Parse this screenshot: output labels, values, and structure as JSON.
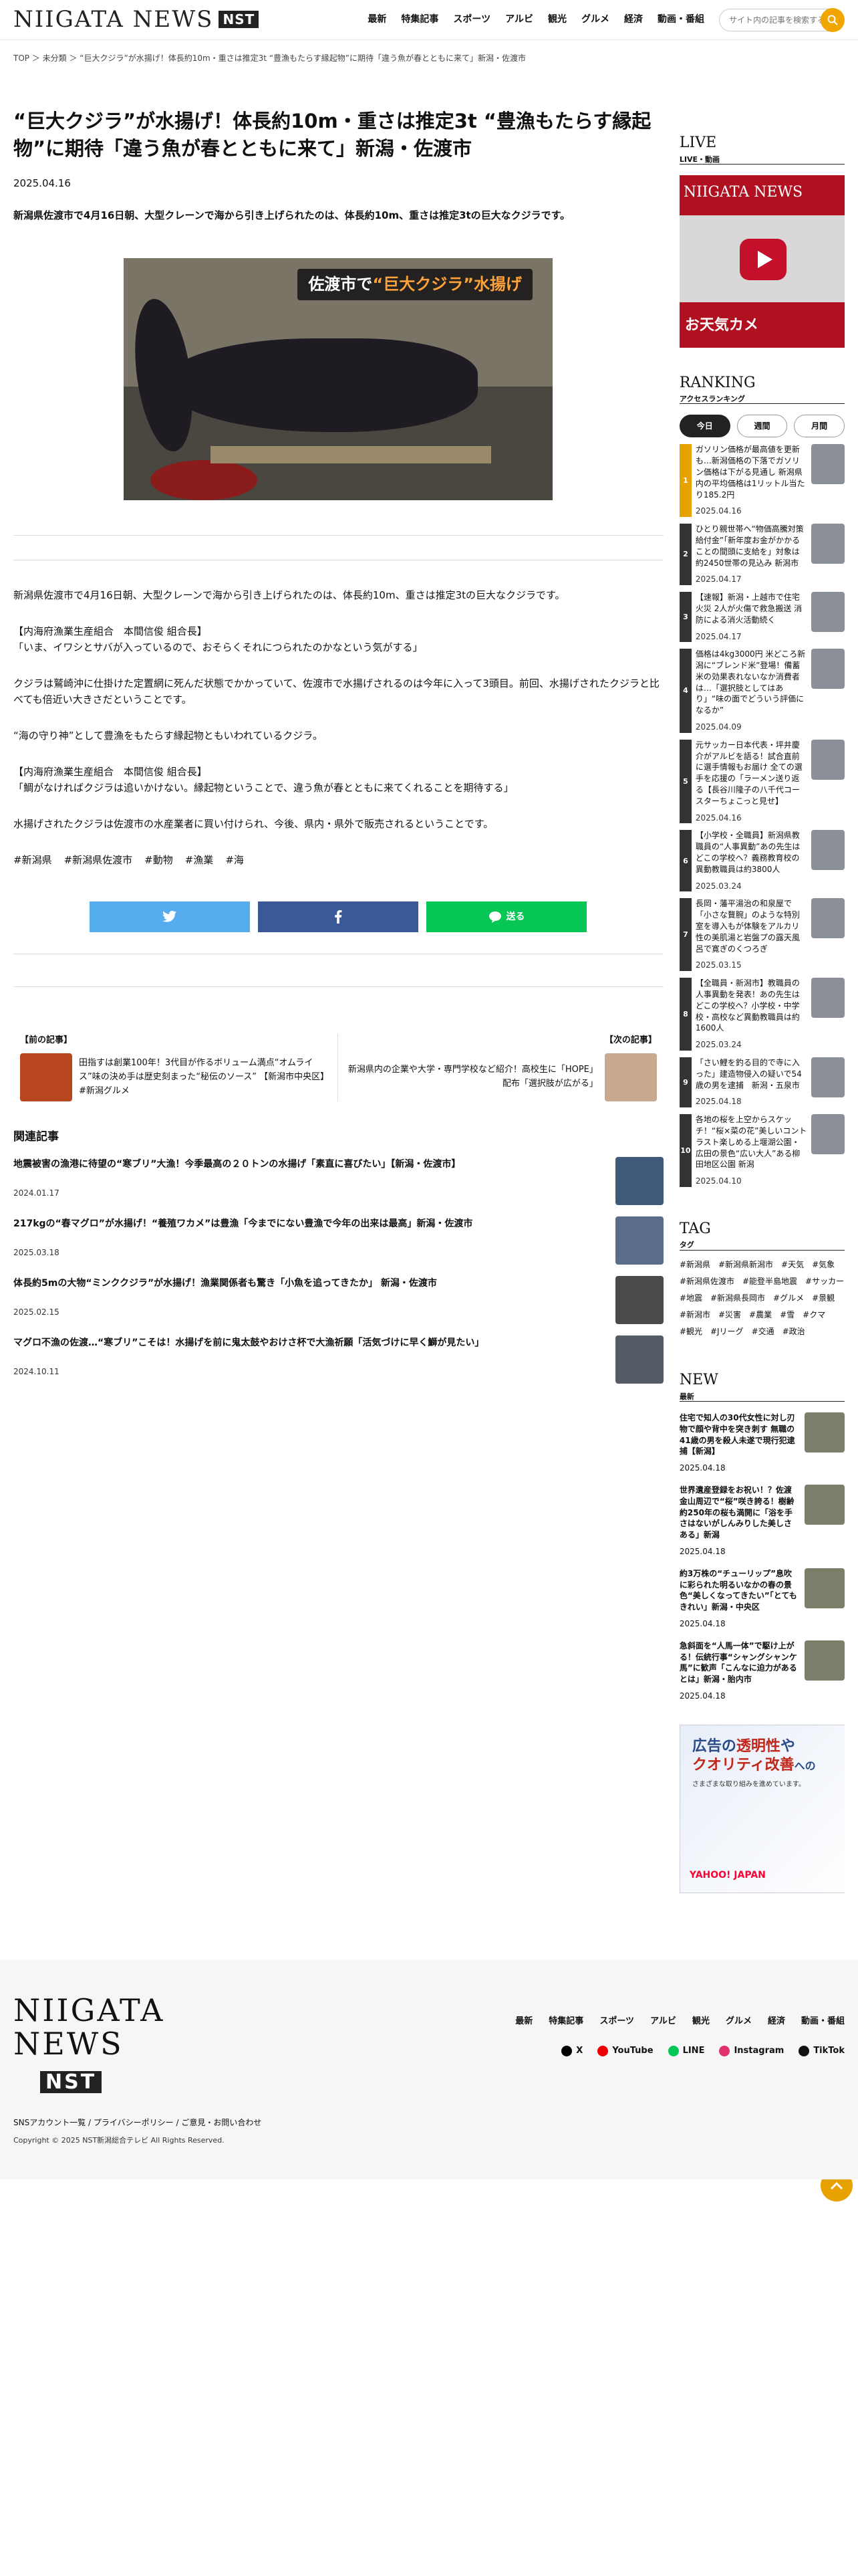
{
  "header": {
    "logo_text": "NIIGATA NEWS",
    "logo_badge": "NST",
    "nav": [
      "最新",
      "特集記事",
      "スポーツ",
      "アルビ",
      "観光",
      "グルメ",
      "経済",
      "動画・番組"
    ],
    "search_placeholder": "サイト内の記事を検索する"
  },
  "breadcrumb": "TOP ＞ 未分類 ＞ “巨大クジラ”が水揚げ！体長約10m・重さは推定3t “豊漁もたらす縁起物”に期待「違う魚が春とともに来て」新潟・佐渡市",
  "article": {
    "title": "“巨大クジラ”が水揚げ！体長約10m・重さは推定3t “豊漁もたらす縁起物”に期待「違う魚が春とともに来て」新潟・佐渡市",
    "date": "2025.04.16",
    "lead": "新潟県佐渡市で4月16日朝、大型クレーンで海から引き上げられたのは、体長約10m、重さは推定3tの巨大なクジラです。",
    "image_caption_a": "佐渡市で",
    "image_caption_b": "“巨大クジラ”水揚げ",
    "paragraphs": [
      "新潟県佐渡市で4月16日朝、大型クレーンで海から引き上げられたのは、体長約10m、重さは推定3tの巨大なクジラです。",
      "【内海府漁業生産組合　本間信俊 組合長】\n「いま、イワシとサバが入っているので、おそらくそれにつられたのかなという気がする」",
      "クジラは鷲崎沖に仕掛けた定置網に死んだ状態でかかっていて、佐渡市で水揚げされるのは今年に入って3頭目。前回、水揚げされたクジラと比べても倍近い大きさだということです。",
      "“海の守り神”として豊漁をもたらす縁起物ともいわれているクジラ。",
      "【内海府漁業生産組合　本間信俊 組合長】\n「鯛がなければクジラは追いかけない。縁起物ということで、違う魚が春とともに来てくれることを期待する」",
      "水揚げされたクジラは佐渡市の水産業者に買い付けられ、今後、県内・県外で販売されるということです。"
    ],
    "tags": [
      "#新潟県",
      "#新潟県佐渡市",
      "#動物",
      "#漁業",
      "#海"
    ],
    "share": {
      "x": "",
      "facebook": "",
      "line": "送る"
    }
  },
  "prevnext": {
    "prev_label": "【前の記事】",
    "prev_title": "田指すは創業100年！3代目が作るボリューム満点“オムライス”味の決め手は歴史刻まった“秘伝のソース” 【新潟市中央区】#新潟グルメ",
    "next_label": "【次の記事】",
    "next_title": "新潟県内の企業や大学・専門学校など紹介！高校生に「HOPE」配布「選択肢が広がる」"
  },
  "related": {
    "heading": "関連記事",
    "items": [
      {
        "title": "地震被害の漁港に待望の“寒ブリ”大漁！今季最高の２０トンの水揚げ「素直に喜びたい」【新潟・佐渡市】",
        "date": "2024.01.17"
      },
      {
        "title": "217kgの“春マグロ”が水揚げ！“養殖ワカメ”は豊漁「今までにない豊漁で今年の出来は最高」新潟・佐渡市",
        "date": "2025.03.18"
      },
      {
        "title": "体長約5mの大物“ミンククジラ”が水揚げ！漁業関係者も驚き「小魚を追ってきたか」 新潟・佐渡市",
        "date": "2025.02.15"
      },
      {
        "title": "マグロ不漁の佐渡…“寒ブリ”こそは！水揚げを前に鬼太鼓やおけさ杯で大漁祈願「活気づけに早く鰤が見たい」",
        "date": "2024.10.11"
      }
    ]
  },
  "sidebar": {
    "live": {
      "heading": "LIVE",
      "sub": "LIVE・動画",
      "banner": "お天気カメ"
    },
    "ranking": {
      "heading": "RANKING",
      "sub": "アクセスランキング",
      "tabs": [
        "今日",
        "週間",
        "月間"
      ],
      "items": [
        {
          "n": "1",
          "title": "ガソリン価格が最高値を更新も…新潟価格の下落でガソリン価格は下がる見通し 新潟県内の平均価格は1リットル当たり185.2円",
          "date": "2025.04.16"
        },
        {
          "n": "2",
          "title": "ひとり親世帯へ“物価高騰対策給付金”「新年度お金がかかることの間頭に支給を」対象は約2450世帯の見込み 新潟市",
          "date": "2025.04.17"
        },
        {
          "n": "3",
          "title": "【速報】新潟・上越市で住宅火災 2人が火傷で救急搬送 消防による消火活動続く",
          "date": "2025.04.17"
        },
        {
          "n": "4",
          "title": "価格は4kg3000円 米どころ新潟に“ブレンド米”登場！備蓄米の効果表れないなか消費者は…「選択肢としてはあり」“味の面でどういう評価になるか”",
          "date": "2025.04.09"
        },
        {
          "n": "5",
          "title": "元サッカー日本代表・坪井慶介がアルビを語る！試合直前に選手情報もお届け 全ての選手を応援の「ラーメン送り返る【長谷川隆子の八千代コースターちょこっと見せ】",
          "date": "2025.04.16"
        },
        {
          "n": "6",
          "title": "【小学校・全職員】新潟県教職員の“人事異動”あの先生はどこの学校へ？義務教育校の異動教職員は約3800人",
          "date": "2025.03.24"
        },
        {
          "n": "7",
          "title": "長岡・藩平湯治の和泉屋で「小さな贅腕」のような特別室を導入もが体験をアルカリ性の美肌湯と岩盤プの露天風呂で寛ぎのくつろぎ",
          "date": "2025.03.15"
        },
        {
          "n": "8",
          "title": "【全職員・新潟市】教職員の人事異動を発表！あの先生はどこの学校へ？小学校・中学校・高校など異動教職員は約1600人",
          "date": "2025.03.24"
        },
        {
          "n": "9",
          "title": "「さい鯉を釣る目的で寺に入った」建造物侵入の疑いで54歳の男を逮捕　新潟・五泉市",
          "date": "2025.04.18"
        },
        {
          "n": "10",
          "title": "各地の桜を上空からスケッチ！“桜×菜の花”美しいコントラスト楽しめる上堰湖公園・広田の景色“広い大人”ある柳田地区公園 新潟",
          "date": "2025.04.10"
        }
      ]
    },
    "tag": {
      "heading": "TAG",
      "sub": "タグ",
      "items": [
        "#新潟県",
        "#新潟県新潟市",
        "#天気",
        "#気象",
        "#新潟県佐渡市",
        "#能登半島地震",
        "#サッカー",
        "#地震",
        "#新潟県長岡市",
        "#グルメ",
        "#景観",
        "#新潟市",
        "#災害",
        "#農業",
        "#雪",
        "#クマ",
        "#観光",
        "#Jリーグ",
        "#交通",
        "#政治"
      ]
    },
    "new": {
      "heading": "NEW",
      "sub": "最新",
      "items": [
        {
          "title": "住宅で知人の30代女性に対し刃物で顔や背中を突き刺す 無職の41歳の男を殺人未遂で現行犯逮捕【新潟】",
          "date": "2025.04.18"
        },
        {
          "title": "世界遺産登録をお祝い！？佐渡金山周辺で“桜”咲き誇る！樹齢約250年の桜も満開に「浴を手さはないがしんみりした美しさある」新潟",
          "date": "2025.04.18"
        },
        {
          "title": "約3万株の“チューリップ”息吹に彩られた明るいなかの春の景色“美しくなってきたい”「とてもきれい」新潟・中央区",
          "date": "2025.04.18"
        },
        {
          "title": "急斜面を“人馬一体”で駆け上がる！伝統行事“シャングシャンケ馬”に歓声「こんなに迫力があるとは」新潟・胎内市",
          "date": "2025.04.18"
        }
      ]
    },
    "ad": {
      "line1a": "広告の",
      "line1b": "透明性",
      "line1c": "や",
      "line2a": "クオリティ改善",
      "line2b": "への",
      "line3": "さまざまな取り組みを進めています。",
      "brand": "YAHOO! JAPAN"
    }
  },
  "footer": {
    "logo_text": "NIIGATA NEWS",
    "logo_badge": "NST",
    "nav": [
      "最新",
      "特集記事",
      "スポーツ",
      "アルビ",
      "観光",
      "グルメ",
      "経済",
      "動画・番組"
    ],
    "sns": [
      "X",
      "YouTube",
      "LINE",
      "Instagram",
      "TikTok"
    ],
    "links": "SNSアカウント一覧 / プライバシーポリシー / ご意見・お問い合わせ",
    "copyright": "Copyright © 2025 NST新潟総合テレビ All Rights Reserved."
  },
  "colors": {
    "accent": "#e8a200",
    "twitter": "#55acee",
    "facebook": "#3b5998",
    "line": "#06c755",
    "rank_top": "#e8a200",
    "rank_other": "#333333"
  }
}
